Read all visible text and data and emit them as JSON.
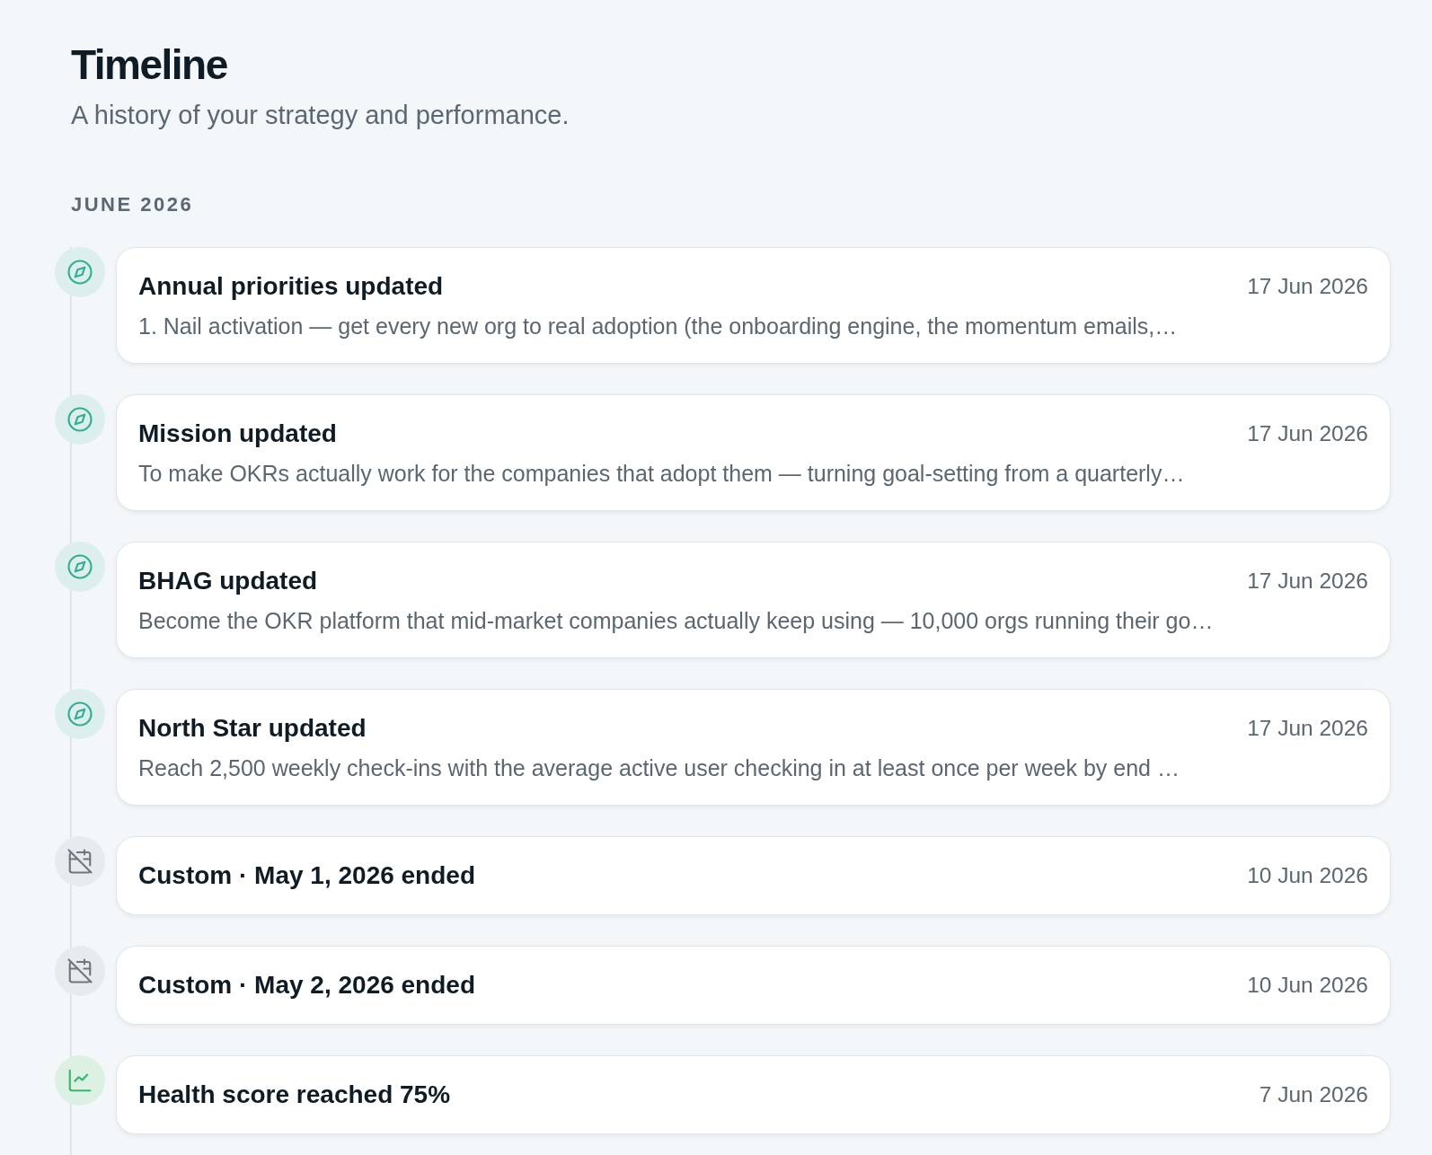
{
  "page": {
    "title": "Timeline",
    "subtitle": "A history of your strategy and performance."
  },
  "sections": [
    {
      "heading": "JUNE 2026",
      "events": [
        {
          "kind": "strategy",
          "title": "Annual priorities updated",
          "description": "1. Nail activation — get every new org to real adoption (the onboarding engine, the momentum emails,…",
          "date": "17 Jun 2026"
        },
        {
          "kind": "strategy",
          "title": "Mission updated",
          "description": "To make OKRs actually work for the companies that adopt them — turning goal-setting from a quarterly…",
          "date": "17 Jun 2026"
        },
        {
          "kind": "strategy",
          "title": "BHAG updated",
          "description": "Become the OKR platform that mid-market companies actually keep using — 10,000 orgs running their go…",
          "date": "17 Jun 2026"
        },
        {
          "kind": "strategy",
          "title": "North Star updated",
          "description": "Reach 2,500 weekly check-ins with the average active user checking in at least once per week by end …",
          "date": "17 Jun 2026"
        },
        {
          "kind": "cycle",
          "title": "Custom · May 1, 2026 ended",
          "date": "10 Jun 2026"
        },
        {
          "kind": "cycle",
          "title": "Custom · May 2, 2026 ended",
          "date": "10 Jun 2026"
        },
        {
          "kind": "health",
          "title": "Health score reached 75%",
          "date": "7 Jun 2026"
        }
      ]
    }
  ]
}
